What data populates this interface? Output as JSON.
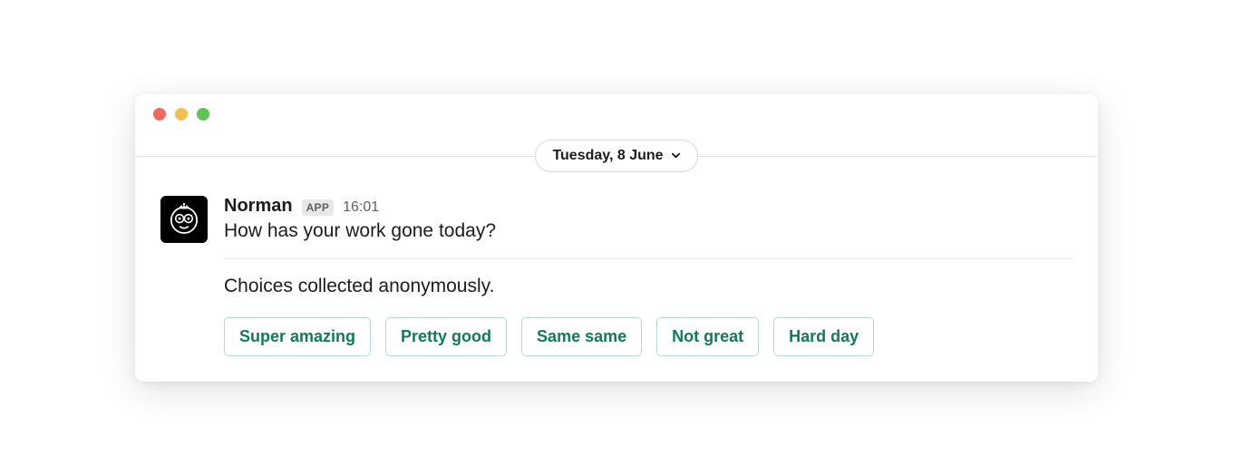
{
  "date_label": "Tuesday, 8 June",
  "message": {
    "author": "Norman",
    "badge": "APP",
    "timestamp": "16:01",
    "question": "How has your work gone today?",
    "note": "Choices collected anonymously.",
    "choices": [
      "Super amazing",
      "Pretty good",
      "Same same",
      "Not great",
      "Hard day"
    ]
  }
}
